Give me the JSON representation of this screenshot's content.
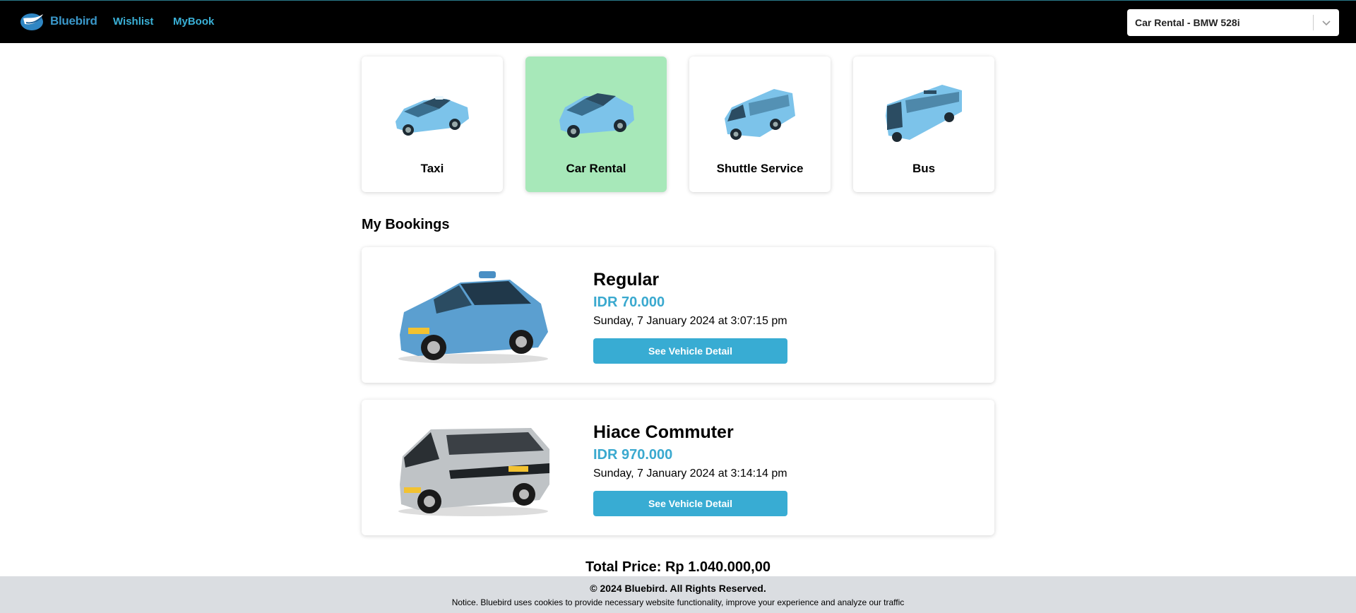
{
  "header": {
    "logo_text": "Bluebird",
    "nav": {
      "wishlist": "Wishlist",
      "mybook": "MyBook"
    },
    "vehicle_select": {
      "value": "Car Rental - BMW 528i"
    }
  },
  "services": [
    {
      "label": "Taxi",
      "icon": "taxi-sedan-icon",
      "active": false
    },
    {
      "label": "Car Rental",
      "icon": "suv-icon",
      "active": true
    },
    {
      "label": "Shuttle Service",
      "icon": "van-icon",
      "active": false
    },
    {
      "label": "Bus",
      "icon": "bus-icon",
      "active": false
    }
  ],
  "bookings": {
    "title": "My Bookings",
    "items": [
      {
        "name": "Regular",
        "price": "IDR 70.000",
        "date": "Sunday, 7 January 2024 at 3:07:15 pm",
        "button": "See Vehicle Detail",
        "image": "blue-taxi-minivan"
      },
      {
        "name": "Hiace Commuter",
        "price": "IDR 970.000",
        "date": "Sunday, 7 January 2024 at 3:14:14 pm",
        "button": "See Vehicle Detail",
        "image": "silver-hiace-van"
      }
    ]
  },
  "total": "Total Price: Rp 1.040.000,00",
  "footer": {
    "copyright": "© 2024 Bluebird. All Rights Reserved.",
    "notice": "Notice. Bluebird uses cookies to provide necessary website functionality, improve your experience and analyze our traffic"
  },
  "colors": {
    "accent": "#38acd3",
    "active_card": "#a7e8b9",
    "header_bg": "#000000",
    "footer_bg": "#dadde1"
  }
}
